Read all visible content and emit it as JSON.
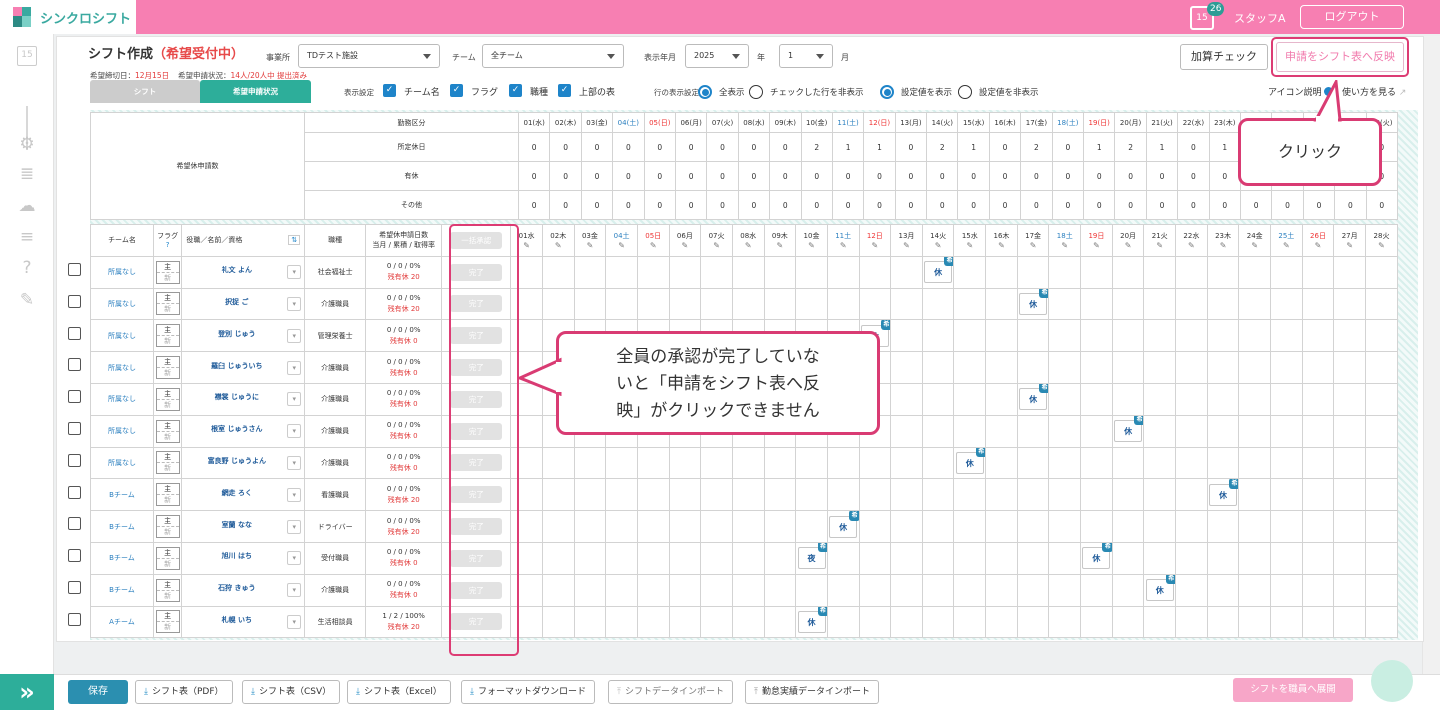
{
  "app": {
    "title": "シンクロシフト",
    "badge": "26",
    "cal_day": "15",
    "user": "スタッフA",
    "logout": "ログアウト"
  },
  "page": {
    "title": "シフト作成",
    "status": "（希望受付中）",
    "deadline_label": "希望締切日：",
    "deadline": "12月15日",
    "apply_label": "希望申請状況：",
    "apply_status": "14人/20人中 提出済み"
  },
  "filters": {
    "office_label": "事業所",
    "office": "TDテスト施設",
    "team_label": "チーム",
    "team": "全チーム",
    "period_label": "表示年月",
    "year": "2025",
    "year_unit": "年",
    "month": "1",
    "month_unit": "月"
  },
  "tabs": [
    "シフト",
    "希望申請状況"
  ],
  "display": {
    "label": "表示設定",
    "options": [
      "チーム名",
      "フラグ",
      "職種",
      "上部の表"
    ],
    "row_label": "行の表示設定",
    "row_opts": [
      "全表示",
      "チェックした行を非表示"
    ],
    "set_opts": [
      "設定値を表示",
      "設定値を非表示"
    ]
  },
  "actions": {
    "add_check": "加算チェック",
    "reflect": "申請をシフト表へ反映",
    "icon_help": "アイコン説明",
    "howto": "使い方を見る"
  },
  "summary": {
    "title": "希望休申請数",
    "header": "勤務区分",
    "rows": [
      {
        "label": "所定休日",
        "values": [
          "0",
          "0",
          "0",
          "0",
          "0",
          "0",
          "0",
          "0",
          "0",
          "2",
          "1",
          "1",
          "0",
          "2",
          "1",
          "0",
          "2",
          "0",
          "1",
          "2",
          "1",
          "0",
          "1",
          "0",
          "0",
          "0",
          "0",
          "0"
        ]
      },
      {
        "label": "有休",
        "values": [
          "0",
          "0",
          "0",
          "0",
          "0",
          "0",
          "0",
          "0",
          "0",
          "0",
          "0",
          "0",
          "0",
          "0",
          "0",
          "0",
          "0",
          "0",
          "0",
          "0",
          "0",
          "0",
          "0",
          "0",
          "0",
          "0",
          "0",
          "0"
        ]
      },
      {
        "label": "その他",
        "values": [
          "0",
          "0",
          "0",
          "0",
          "0",
          "0",
          "0",
          "0",
          "0",
          "0",
          "0",
          "0",
          "0",
          "0",
          "0",
          "0",
          "0",
          "0",
          "0",
          "0",
          "0",
          "0",
          "0",
          "0",
          "0",
          "0",
          "0",
          "0"
        ]
      }
    ]
  },
  "days_top": [
    "01(水)",
    "02(木)",
    "03(金)",
    "04(土)",
    "05(日)",
    "06(月)",
    "07(火)",
    "08(水)",
    "09(木)",
    "10(金)",
    "11(土)",
    "12(日)",
    "13(月)",
    "14(火)",
    "15(水)",
    "16(木)",
    "17(金)",
    "18(土)",
    "19(日)",
    "20(月)",
    "21(火)",
    "22(水)",
    "23(木)",
    "24(金)",
    "25(土)",
    "26(日)",
    "27(月)",
    "28(火)"
  ],
  "days": [
    "01水",
    "02木",
    "03金",
    "04土",
    "05日",
    "06月",
    "07火",
    "08水",
    "09木",
    "10金",
    "11土",
    "12日",
    "13月",
    "14火",
    "15水",
    "16木",
    "17金",
    "18土",
    "19日",
    "20月",
    "21火",
    "22水",
    "23木",
    "24金",
    "25土",
    "26日",
    "27月",
    "28火"
  ],
  "grid": {
    "team_h": "チーム名",
    "flag_h": "フラグ",
    "name_h": "役職／名前／資格",
    "job_h": "職種",
    "stat_h1": "希望休申請日数",
    "stat_h2": "当月 / 累積 / 取得率",
    "approve_all": "一括承認",
    "flag_top": "主",
    "flag_bot": "新",
    "remain_label": "残有休",
    "done": "完了",
    "kyu": "休",
    "yoru": "夜",
    "pen": "✎"
  },
  "staff": [
    {
      "team": "所属なし",
      "name": "礼文 よん",
      "job": "社会福祉士",
      "stat": "0 / 0 / 0%",
      "remain": "20"
    },
    {
      "team": "所属なし",
      "name": "択捉 ご",
      "job": "介護職員",
      "stat": "0 / 0 / 0%",
      "remain": "20"
    },
    {
      "team": "所属なし",
      "name": "登別 じゅう",
      "job": "管理栄養士",
      "stat": "0 / 0 / 0%",
      "remain": "0"
    },
    {
      "team": "所属なし",
      "name": "羅臼 じゅういち",
      "job": "介護職員",
      "stat": "0 / 0 / 0%",
      "remain": "0"
    },
    {
      "team": "所属なし",
      "name": "襟裳 じゅうに",
      "job": "介護職員",
      "stat": "0 / 0 / 0%",
      "remain": "0"
    },
    {
      "team": "所属なし",
      "name": "根室 じゅうさん",
      "job": "介護職員",
      "stat": "0 / 0 / 0%",
      "remain": "0"
    },
    {
      "team": "所属なし",
      "name": "富良野 じゅうよん",
      "job": "介護職員",
      "stat": "0 / 0 / 0%",
      "remain": "0"
    },
    {
      "team": "Bチーム",
      "name": "網走 ろく",
      "job": "看護職員",
      "stat": "0 / 0 / 0%",
      "remain": "20"
    },
    {
      "team": "Bチーム",
      "name": "室蘭 なな",
      "job": "ドライバー",
      "stat": "0 / 0 / 0%",
      "remain": "20"
    },
    {
      "team": "Bチーム",
      "name": "旭川 はち",
      "job": "受付職員",
      "stat": "0 / 0 / 0%",
      "remain": "0"
    },
    {
      "team": "Bチーム",
      "name": "石狩 きゅう",
      "job": "介護職員",
      "stat": "0 / 0 / 0%",
      "remain": "0"
    },
    {
      "team": "Aチーム",
      "name": "札幌 いち",
      "job": "生活相談員",
      "stat": "1 / 2 / 100%",
      "remain": "20"
    }
  ],
  "callouts": {
    "click": "クリック",
    "note_l1": "全員の承認が完了していな",
    "note_l2": "いと「申請をシフト表へ反",
    "note_l3": "映」がクリックできません"
  },
  "footer": {
    "save": "保存",
    "buttons": [
      "シフト表（PDF）",
      "シフト表（CSV）",
      "シフト表（Excel）",
      "フォーマットダウンロード",
      "シフトデータインポート",
      "勤怠実績データインポート"
    ],
    "expand": "シフトを職員へ展開"
  },
  "colors": {
    "brand_pink": "#f77fb2",
    "accent_teal": "#2dae9a",
    "highlight": "#dd3c74",
    "link_blue": "#1e84c9"
  }
}
